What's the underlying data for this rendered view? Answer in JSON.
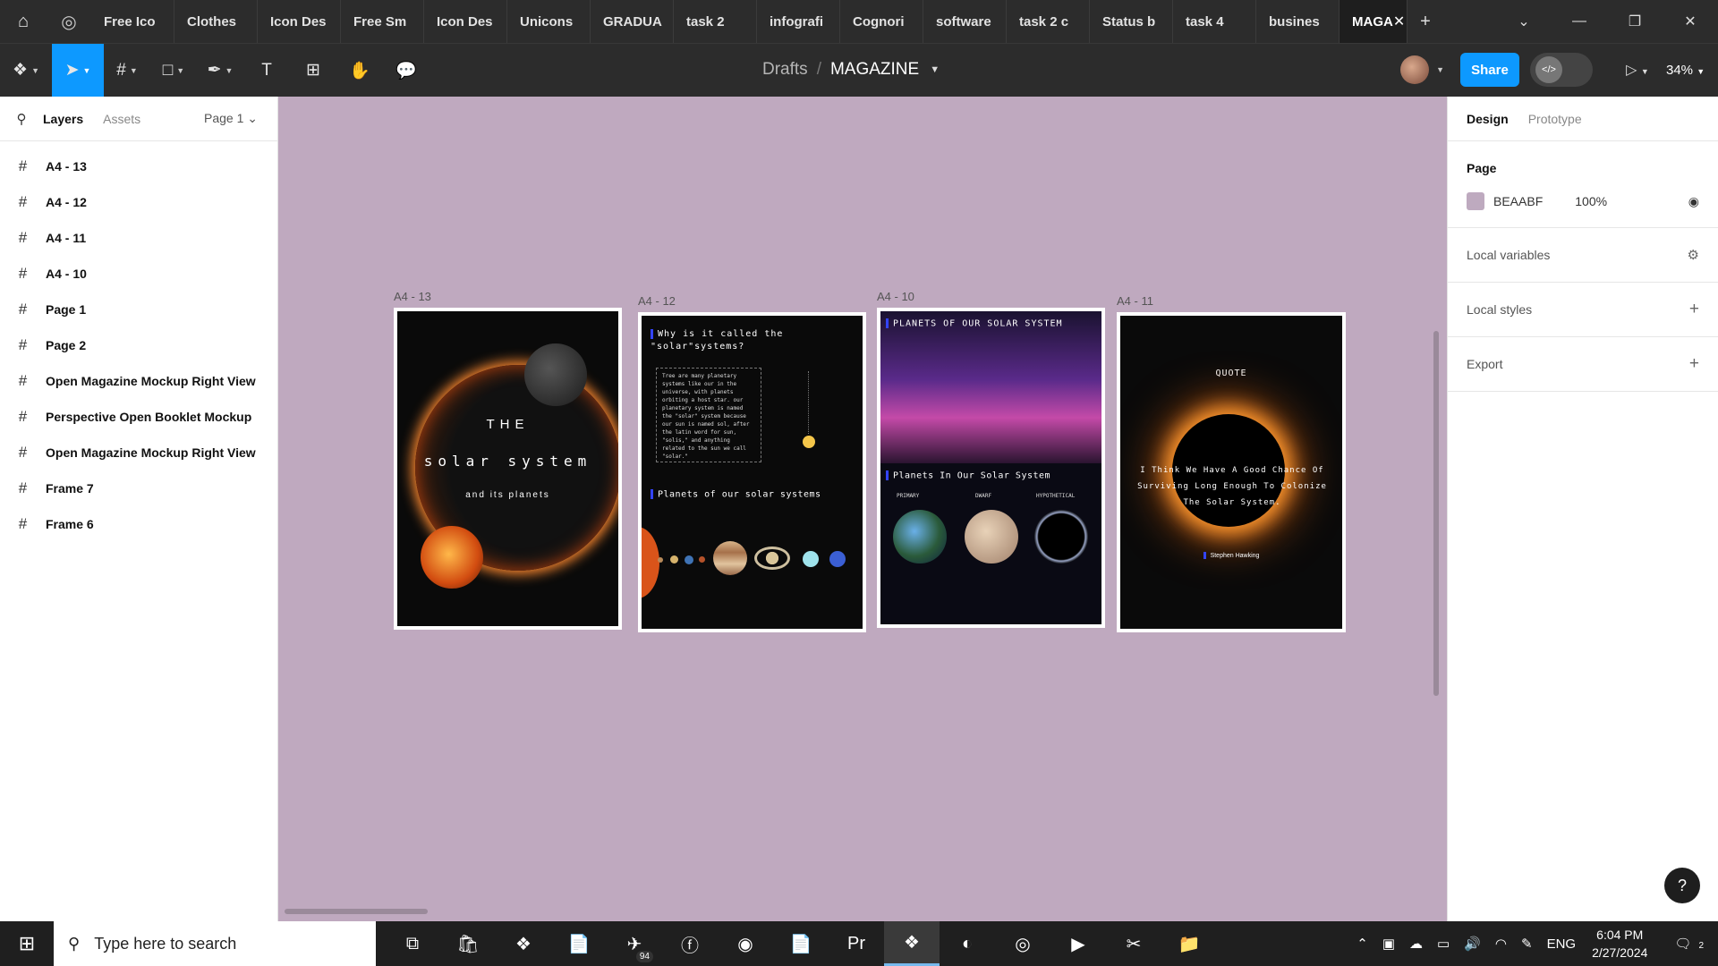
{
  "tabs": [
    "Free Ico",
    "Clothes",
    "Icon Des",
    "Free Sm",
    "Icon Des",
    "Unicons",
    "GRADUA",
    "task 2",
    "infografi",
    "Cognori",
    "software",
    "task 2 c",
    "Status b",
    "task 4",
    "busines"
  ],
  "active_tab": "MAGA",
  "breadcrumb": {
    "folder": "Drafts",
    "file": "MAGAZINE"
  },
  "share_label": "Share",
  "zoom": "34%",
  "left_panel": {
    "tab_layers": "Layers",
    "tab_assets": "Assets",
    "page_selector": "Page 1",
    "layers": [
      "A4 - 13",
      "A4 - 12",
      "A4 - 11",
      "A4 - 10",
      "Page 1",
      "Page 2",
      "Open Magazine Mockup Right View",
      "Perspective Open Booklet Mockup",
      "Open Magazine Mockup Right View",
      "Frame 7",
      "Frame 6"
    ]
  },
  "right_panel": {
    "tab_design": "Design",
    "tab_prototype": "Prototype",
    "page_title": "Page",
    "page_color": "BEAABF",
    "page_color_hex": "#beaabf",
    "page_opacity": "100%",
    "local_variables": "Local variables",
    "local_styles": "Local styles",
    "export": "Export"
  },
  "frames": {
    "f1": {
      "label": "A4 - 13",
      "title1": "THE",
      "title2": "solar system",
      "title3": "and its planets"
    },
    "f2": {
      "label": "A4 - 12",
      "heading1": "Why is it called the \"solar\"systems?",
      "body": "Tree are many planetary systems like our in the universe, with planets orbiting a host star. our planetary system is named the \"solar\" system because our sun is named sol, after the latin word for sun, \"solis,\" and anything related to the sun we call \"solar.\"",
      "heading2": "Planets of our solar systems"
    },
    "f3": {
      "label": "A4 - 10",
      "heading1": "PLANETS OF OUR SOLAR SYSTEM",
      "heading2": "Planets In Our Solar System",
      "col1": "PRIMARY",
      "col2": "DWARF",
      "col3": "HYPOTHETICAL"
    },
    "f4": {
      "label": "A4 - 11",
      "heading": "QUOTE",
      "quote": "I Think We Have A Good Chance Of Surviving Long Enough To Colonize The Solar System.",
      "author": "Stephen Hawking"
    }
  },
  "taskbar": {
    "search_placeholder": "Type here to search",
    "telegram_badge": "94",
    "lang": "ENG",
    "time": "6:04 PM",
    "date": "2/27/2024",
    "notifications": "2"
  }
}
